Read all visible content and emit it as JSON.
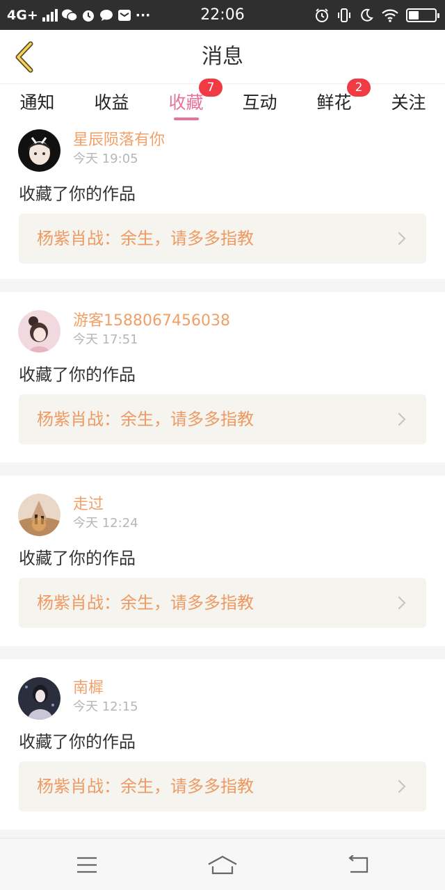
{
  "status_bar": {
    "network": "4G+",
    "notif_icons": [
      "wechat-icon",
      "alarm-icon",
      "chat-bubble-icon",
      "mail-icon"
    ],
    "more": "···",
    "time": "22:06",
    "right_icons": [
      "alarm-icon",
      "vibrate-icon",
      "moon-icon",
      "wifi-icon",
      "battery-icon"
    ],
    "battery_level": 0.35
  },
  "header": {
    "title": "消息",
    "accent_color": "#e8739a"
  },
  "tabs": [
    {
      "label": "通知",
      "badge": ""
    },
    {
      "label": "收益",
      "badge": ""
    },
    {
      "label": "收藏",
      "badge": "7",
      "active": true
    },
    {
      "label": "互动",
      "badge": ""
    },
    {
      "label": "鲜花",
      "badge": "2"
    },
    {
      "label": "关注",
      "badge": ""
    }
  ],
  "items": [
    {
      "username": "星辰陨落有你",
      "time": "今天 19:05",
      "action": "收藏了你的作品",
      "work": "杨紫肖战：余生，请多多指教"
    },
    {
      "username": "游客1588067456038",
      "time": "今天 17:51",
      "action": "收藏了你的作品",
      "work": "杨紫肖战：余生，请多多指教"
    },
    {
      "username": "走过",
      "time": "今天 12:24",
      "action": "收藏了你的作品",
      "work": "杨紫肖战：余生，请多多指教"
    },
    {
      "username": "南樨",
      "time": "今天 12:15",
      "action": "收藏了你的作品",
      "work": "杨紫肖战：余生，请多多指教"
    }
  ],
  "bottom_nav": [
    "menu-icon",
    "home-icon",
    "back-icon"
  ]
}
